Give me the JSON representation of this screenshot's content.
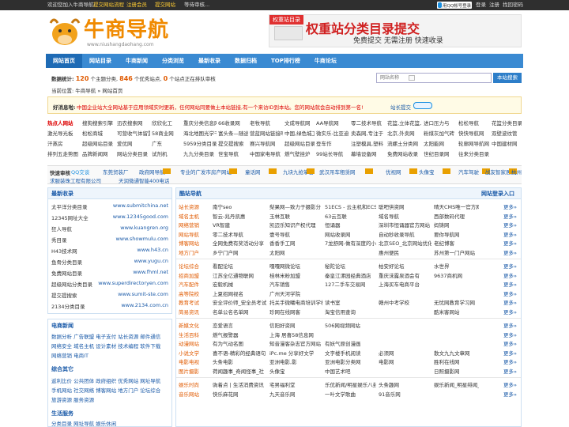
{
  "topbar": {
    "welcome": "欢迎您加入牛商导航:",
    "l1": "提交网站流程",
    "l2": "注册会员",
    "l3": "提交网站",
    "l4": "等待审核...",
    "qq_btn": "用QQ帐号登录",
    "login": "登录",
    "register": "注册",
    "forgot": "找回密码"
  },
  "logo": {
    "cn": "牛商导航",
    "url": "www.niushangdaohang.com"
  },
  "banner": {
    "tag": "权重站目录",
    "title": "权重站分类目录提交",
    "sub": "免费提交 无需注册 快速收录"
  },
  "nav": [
    "网站首页",
    "网站目录",
    "牛商新闻",
    "分类浏览",
    "最新收录",
    "数据归档",
    "TOP排行榜",
    "牛商论坛"
  ],
  "stats": {
    "label": "数据统计:",
    "n1": "120",
    "t1": "个主题分类,",
    "n2": "846",
    "t2": "个优秀站点,",
    "n3": "0",
    "t3": "个站点正在排队审核"
  },
  "search": {
    "placeholder": "网站名称",
    "button": "本站搜索"
  },
  "crumb": "当前位置: 牛商导航 » 网站首页",
  "notice": {
    "label": "好消息啦:",
    "text": "中国企业站大全网站基于应用领域实时更新，任何网站同要做土本站链接,有一个来访ID到本站。您的网站就会自动排到第一名!",
    "link": "站长提交"
  },
  "hot": [
    [
      "热点人网站",
      "搜狗搜索引擎",
      "迅农搜索网",
      "欣欣化工",
      "重庆分类信息网",
      "66收录网",
      "老牧导航",
      "文成导航网",
      "AA导航网",
      "零二技术导航",
      "花篮,立体花篮,",
      "进口压力与",
      "松松导航",
      "花篮分类目录"
    ],
    [
      "激光导光板",
      "松松商城",
      "可营收气体留置",
      "58商业网",
      "海北地图光学干燥",
      "富头条—随途前",
      "营蓝网站链接吧",
      "中国,绿色城工网",
      "微实乐-比亚迪",
      "卖森网,专注于",
      "北京,外卖网",
      "粉煤灰加气砖",
      "快快导航网",
      "双壁波纹管"
    ],
    [
      "汗蒸房",
      "超级网站目录",
      "爱优网",
      "广东",
      "5959分类目录",
      "提交提搜索",
      "赛兴导航网",
      "超级网站目录",
      "登车作",
      "注塑模具,塑料",
      "流螺土分类网",
      "太阳能网",
      "轮廓网导航网",
      "中国建材网"
    ],
    [
      "排列五走势图",
      "品牌新闻网",
      "网站分类目录",
      "试剂机",
      "九九分类目录",
      "世宝导航",
      "中国家电导航",
      "燃气壁挂炉",
      "99站长导航",
      "幕墙设备网",
      "免费网站收录",
      "世纪目录网",
      "往来分类目录",
      ""
    ]
  ],
  "quick": {
    "label": "快速审核",
    "qq": "QQ交谈",
    "items": [
      "东莞贸装厂",
      "政府网导航",
      "专业的广发市房产网站",
      "童话网",
      "九块九抢掌合",
      "武汉吊车租赁网",
      "优视网",
      "头像宝",
      "汽车驾驶",
      "战友智家居网",
      "杭州",
      "求服装珠工程有限公司",
      "天润微通智能400电话"
    ]
  },
  "left": {
    "latest_title": "最新收录",
    "latest": [
      [
        "太平洋分类目录",
        "www.submitchina.net"
      ],
      [
        "12345网址大全",
        "www.12345good.com"
      ],
      [
        "狂人导航",
        "www.kuangren.org"
      ],
      [
        "秀目录",
        "www.showmulu.com"
      ],
      [
        "H43技术网",
        "www.h43.cn"
      ],
      [
        "鱼骨分类目录",
        "www.yugu.cn"
      ],
      [
        "免费网站目录",
        "www.fhml.net"
      ],
      [
        "超级网站分类目录",
        "www.superdirectoryen.com"
      ],
      [
        "提交提搜索",
        "www.sumit-ste.com"
      ],
      [
        "2134分类目录",
        "www.2134.com.cn"
      ]
    ],
    "news_title": "电商新闻",
    "news": [
      "数据分析 广告联盟 电子支付 站长资源 邮件通信",
      "网络安全 域名主机 设计素材 技术编程 软件下载",
      "网络营销 电商IT"
    ],
    "zh_title": "综合其它",
    "zh": [
      "返利比价 公共团体 政府组织 优秀网站 网址导航",
      "手机网站 社交网络 博客网站 地方门户 论坛综合",
      "旅游资源 服务资源"
    ],
    "life_title": "生活服务",
    "life": [
      "分类目录 网址导航 娱乐休闲"
    ]
  },
  "cool": {
    "title": "酷站导航",
    "submit": "网站登录入口",
    "more": "更多»",
    "groups": [
      {
        "rows": [
          [
            "站长资源",
            "南宁seo",
            "梨果网—致力于摄影分",
            "51ECS - 云主机和ECS",
            "聪吧供资网",
            "晴天CMS唯一官方网站"
          ],
          [
            "域名主机",
            "智云-兆丹凯惠",
            "玉林互联",
            "63云互联",
            "域名导航",
            "西部数码代理"
          ],
          [
            "网络营销",
            "VR智建",
            "凯迈乐知识产权代理",
            "恒诵器",
            "深圳市恒诵器官方网站",
            "妈铸网"
          ],
          [
            "网站导航",
            "零二技术导航",
            "壹号导航",
            "网站收录网",
            "自动秒收录导航",
            "要你导航网"
          ],
          [
            "博客网站",
            "全网免费有奖活动分享",
            "香香手工网",
            "7龙舒网-做有深度的小",
            "北京SEO_北京网站优化",
            "老纪博客"
          ],
          [
            "地方门户",
            "乡宁门户网",
            "太阳网",
            "",
            "惠州便民",
            "苏州第一门户网站"
          ]
        ]
      },
      {
        "rows": [
          [
            "论坛综合",
            "看配论坛",
            "嘎嘎网微论坛",
            "秘陀论坛",
            "柏安好论坛",
            "水世界"
          ],
          [
            "招商加盟",
            "江苏全亿通物联网",
            "桂林米粉加盟",
            "秦皇江漯园经典酒店",
            "重庆沫露泉酒会有",
            "9637商机网"
          ],
          [
            "汽车配件",
            "宏毅机械",
            "汽车销售",
            "127二手车交易网",
            "上海买车电商平台",
            ""
          ],
          [
            "高等院校",
            "上夏招网视名",
            "广州天河学院",
            "",
            "",
            ""
          ],
          [
            "教育考试",
            "安全评价师_安全员考试",
            "托关手微曦电商培训学校",
            "读书室",
            "赣州中考学校",
            "无忧网教育学习网"
          ],
          [
            "简易资讯",
            "名单公名名单网",
            "珍网在线网客",
            "淘宝信用查询",
            "",
            "酷米客网站"
          ]
        ]
      },
      {
        "rows": [
          [
            "新媒文化",
            "恋爱语言",
            "信阳好资网",
            "506网视频网站",
            "",
            ""
          ],
          [
            "生活百科",
            "燃气报警器",
            "上海 居喜58信息网",
            "",
            "",
            ""
          ],
          [
            "动漫网站",
            "有为气动名图",
            "知音漫客杂志官方网站",
            "有妖气原创漫画",
            "",
            ""
          ],
          [
            "小说文学",
            "喜不语-精彩的经典语句",
            "iPc.me 分享好文学",
            "文字楼手机阅读",
            "必须网",
            "散文九九文章网"
          ],
          [
            "电影电视",
            "头条电影",
            "亚洲电影,影",
            "亚洲电影分类网",
            "电影网",
            "胜利在线网"
          ],
          [
            "图片摄影",
            "荷闻趣事_奇闻怪事_社",
            "头像宝",
            "中国艺术吧",
            "",
            "日照摄影网"
          ]
        ]
      },
      {
        "rows": [
          [
            "娱乐时尚",
            "驹着点 | 生活消费资讯",
            "宅男福利堂",
            "乐优新闻/明星娱乐八卦",
            "头条趣网",
            "娱乐新闻_明星绯闻_影"
          ],
          [
            "音乐网站",
            "快乐麻花网",
            "九天音乐网",
            "一叶文学歌曲",
            "91音乐网",
            ""
          ]
        ]
      }
    ]
  }
}
